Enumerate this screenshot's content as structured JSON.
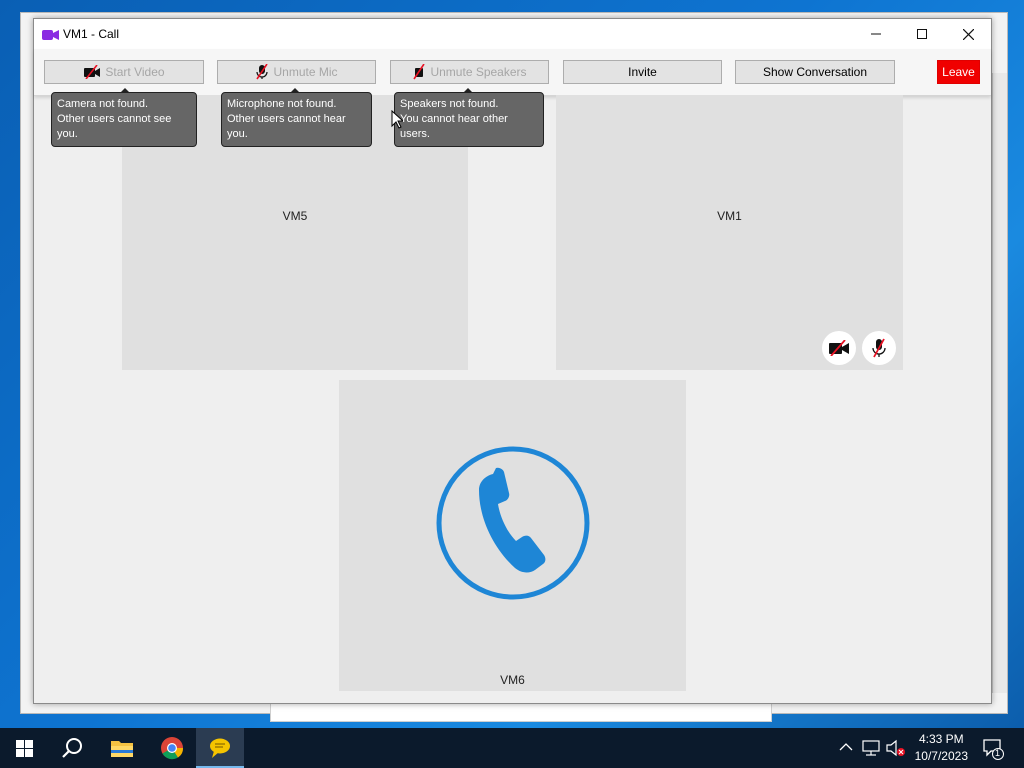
{
  "window": {
    "title": "VM1 - Call"
  },
  "toolbar": {
    "start_video": "Start Video",
    "unmute_mic": "Unmute Mic",
    "unmute_speakers": "Unmute Speakers",
    "invite": "Invite",
    "show_conversation": "Show Conversation",
    "leave": "Leave"
  },
  "tooltips": {
    "camera": {
      "line1": "Camera not found.",
      "line2": "Other users cannot see you."
    },
    "microphone": {
      "line1": "Microphone not found.",
      "line2": "Other users cannot hear you."
    },
    "speakers": {
      "line1": "Speakers not found.",
      "line2": "You cannot hear other users."
    }
  },
  "participants": [
    {
      "name": "VM5"
    },
    {
      "name": "VM1"
    },
    {
      "name": "VM6"
    }
  ],
  "taskbar": {
    "time": "4:33 PM",
    "date": "10/7/2023",
    "notification_count": "1"
  },
  "colors": {
    "leave": "#f00000",
    "phone_blue": "#1e86d6",
    "muted_red": "#e81123"
  }
}
